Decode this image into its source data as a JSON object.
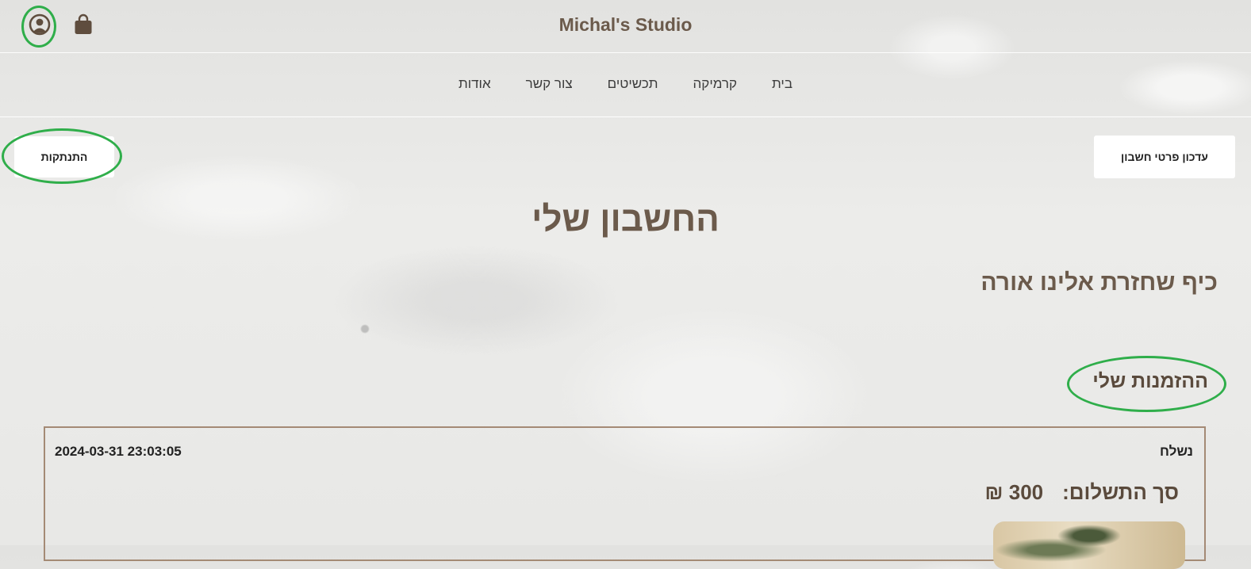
{
  "header": {
    "brand": "Michal's Studio",
    "icons": [
      "user-circle-icon",
      "shopping-bag-icon"
    ]
  },
  "nav": {
    "items": [
      {
        "label": "בית"
      },
      {
        "label": "קרמיקה"
      },
      {
        "label": "תכשיטים"
      },
      {
        "label": "צור קשר"
      },
      {
        "label": "אודות"
      }
    ]
  },
  "account": {
    "update_button": "עדכון פרטי חשבון",
    "logout_button": "התנתקות",
    "title": "החשבון שלי",
    "greeting": "כיף שחזרת אלינו אורה"
  },
  "orders": {
    "title": "ההזמנות שלי",
    "items": [
      {
        "status": "נשלח",
        "date": "2024-03-31 23:03:05",
        "total_label": "סך התשלום:",
        "total_value": "300 ₪"
      }
    ]
  },
  "colors": {
    "brand_text": "#6b5a4b",
    "highlight": "#2fae4a",
    "card_border": "#a48a75"
  }
}
